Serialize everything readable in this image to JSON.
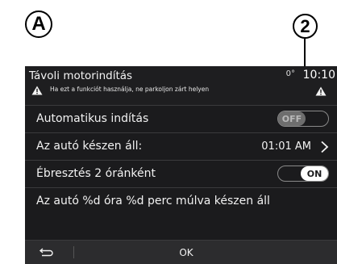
{
  "callouts": {
    "a": "A",
    "two": "2"
  },
  "header": {
    "title": "Távoli motorindítás",
    "temperature": "0°",
    "clock": "10:10",
    "warning": "Ha ezt a funkciót használja, ne parkoljon zárt helyen"
  },
  "rows": {
    "auto_start": {
      "label": "Automatikus indítás",
      "toggle": "OFF"
    },
    "car_ready": {
      "label": "Az autó készen áll:",
      "value": "01:01 AM"
    },
    "wake": {
      "label": "Ébresztés 2 óránként",
      "toggle": "ON"
    },
    "info": {
      "label": "Az autó %d óra %d perc múlva készen áll"
    }
  },
  "footer": {
    "ok_label": "OK"
  },
  "icons": {
    "back": "back-arrow-icon",
    "warning": "warning-triangle-icon",
    "chevron": "chevron-right-icon"
  }
}
